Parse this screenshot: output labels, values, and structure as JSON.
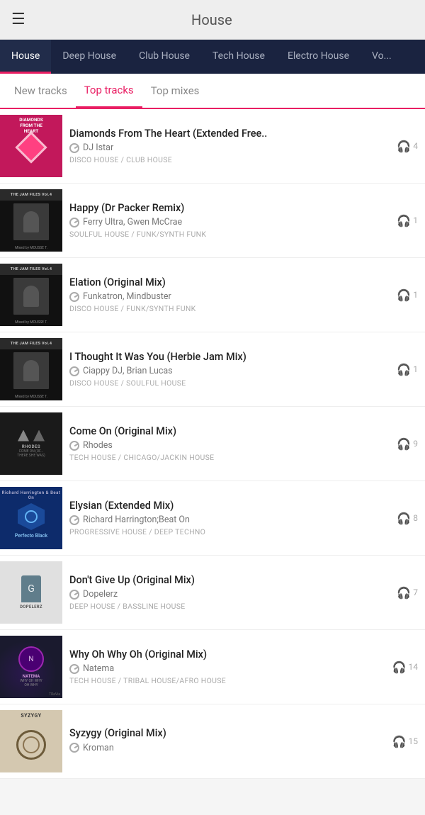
{
  "header": {
    "title": "House",
    "menu_label": "☰"
  },
  "genre_tabs": {
    "items": [
      {
        "id": "house",
        "label": "House",
        "active": true
      },
      {
        "id": "deep-house",
        "label": "Deep House",
        "active": false
      },
      {
        "id": "club-house",
        "label": "Club House",
        "active": false
      },
      {
        "id": "tech-house",
        "label": "Tech House",
        "active": false
      },
      {
        "id": "electro-house",
        "label": "Electro House",
        "active": false
      },
      {
        "id": "vocal",
        "label": "Vo...",
        "active": false
      }
    ]
  },
  "sub_tabs": {
    "items": [
      {
        "id": "new-tracks",
        "label": "New tracks",
        "active": false
      },
      {
        "id": "top-tracks",
        "label": "Top tracks",
        "active": true
      },
      {
        "id": "top-mixes",
        "label": "Top mixes",
        "active": false
      }
    ]
  },
  "tracks": [
    {
      "id": 1,
      "title": "Diamonds From The Heart (Extended Free..",
      "artist": "DJ Istar",
      "genre": "DISCO HOUSE / CLUB HOUSE",
      "plays": "4",
      "thumb_type": "diamonds"
    },
    {
      "id": 2,
      "title": "Happy (Dr Packer Remix)",
      "artist": "Ferry Ultra, Gwen McCrae",
      "genre": "SOULFUL HOUSE / FUNK/SYNTH FUNK",
      "plays": "1",
      "thumb_type": "jam"
    },
    {
      "id": 3,
      "title": "Elation (Original Mix)",
      "artist": "Funkatron, Mindbuster",
      "genre": "DISCO HOUSE / FUNK/SYNTH FUNK",
      "plays": "1",
      "thumb_type": "jam"
    },
    {
      "id": 4,
      "title": "I Thought It Was You (Herbie Jam Mix)",
      "artist": "Ciappy DJ, Brian Lucas",
      "genre": "DISCO HOUSE / SOULFUL HOUSE",
      "plays": "1",
      "thumb_type": "jam"
    },
    {
      "id": 5,
      "title": "Come On (Original Mix)",
      "artist": "Rhodes",
      "genre": "TECH HOUSE / CHICAGO/JACKIN HOUSE",
      "plays": "9",
      "thumb_type": "come-on"
    },
    {
      "id": 6,
      "title": "Elysian (Extended Mix)",
      "artist": "Richard Harrington;Beat On",
      "genre": "PROGRESSIVE HOUSE / DEEP TECHNO",
      "plays": "8",
      "thumb_type": "elysian"
    },
    {
      "id": 7,
      "title": "Don't Give Up (Original Mix)",
      "artist": "Dopelerz",
      "genre": "DEEP HOUSE / BASSLINE HOUSE",
      "plays": "7",
      "thumb_type": "dont"
    },
    {
      "id": 8,
      "title": "Why Oh Why Oh (Original Mix)",
      "artist": "Natema",
      "genre": "TECH HOUSE / TRIBAL HOUSE/AFRO HOUSE",
      "plays": "14",
      "thumb_type": "why"
    },
    {
      "id": 9,
      "title": "Syzygy (Original Mix)",
      "artist": "Kroman",
      "genre": "",
      "plays": "15",
      "thumb_type": "syzygy"
    }
  ]
}
